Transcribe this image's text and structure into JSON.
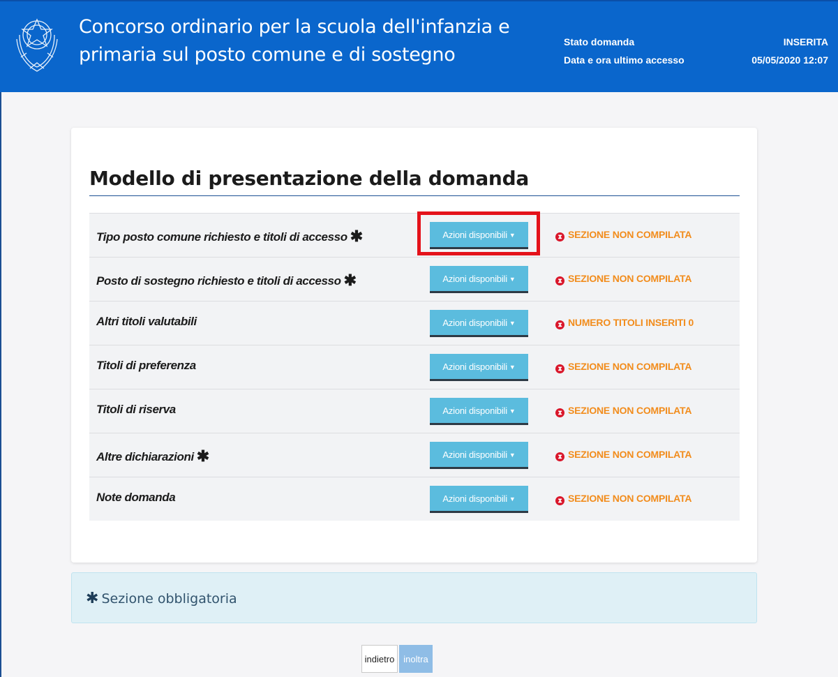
{
  "header": {
    "title_line1": "Concorso ordinario per la scuola dell'infanzia e",
    "title_line2": "primaria sul posto comune e di sostegno",
    "status_label": "Stato domanda",
    "status_value": "INSERITA",
    "access_label": "Data e ora ultimo accesso",
    "access_value": "05/05/2020 12:07",
    "emblem_icon": "italian-republic-emblem-icon"
  },
  "main": {
    "title": "Modello di presentazione della domanda",
    "action_label": "Azioni disponibili",
    "required_mark": "✱",
    "rows": [
      {
        "label": "Tipo posto comune richiesto e titoli di accesso",
        "required": true,
        "status": "SEZIONE NON COMPILATA"
      },
      {
        "label": "Posto di sostegno richiesto e titoli di accesso",
        "required": true,
        "status": "SEZIONE NON COMPILATA"
      },
      {
        "label": "Altri titoli valutabili",
        "required": false,
        "status": "NUMERO TITOLI INSERITI 0"
      },
      {
        "label": "Titoli di preferenza",
        "required": false,
        "status": "SEZIONE NON COMPILATA"
      },
      {
        "label": "Titoli di riserva",
        "required": false,
        "status": "SEZIONE NON COMPILATA"
      },
      {
        "label": "Altre dichiarazioni",
        "required": true,
        "status": "SEZIONE NON COMPILATA"
      },
      {
        "label": "Note domanda",
        "required": false,
        "status": "SEZIONE NON COMPILATA"
      }
    ]
  },
  "info": {
    "text": "Sezione obbligatoria"
  },
  "footer": {
    "back_label": "indietro",
    "send_label": "inoltra"
  },
  "colors": {
    "header_bg": "#0a66cc",
    "action_btn": "#5bbcde",
    "status_text": "#f28c1c",
    "status_icon": "#d9162a",
    "highlight": "#e4121a"
  }
}
